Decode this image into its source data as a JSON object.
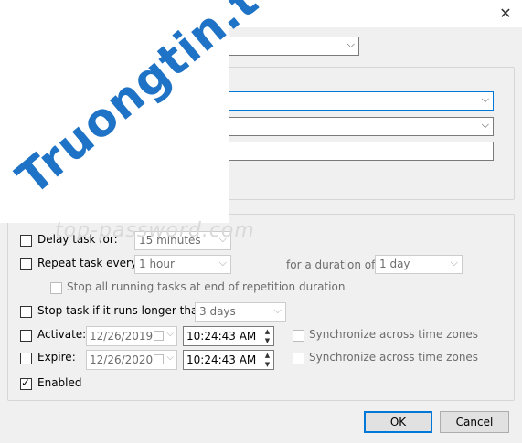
{
  "dialog": {
    "close_glyph": "✕"
  },
  "top_combo": {
    "value": ""
  },
  "settings": {
    "combo1": {
      "value": ""
    },
    "combo2": {
      "value": ""
    },
    "textbox": {
      "value": ""
    }
  },
  "advanced": {
    "delay_task": {
      "label": "Delay task for:",
      "checked": false,
      "value": "15 minutes"
    },
    "repeat_task": {
      "label": "Repeat task every:",
      "checked": false,
      "value": "1 hour"
    },
    "duration": {
      "label": "for a duration of:",
      "value": "1 day"
    },
    "stop_running": {
      "label": "Stop all running tasks at end of repetition duration",
      "checked": false
    },
    "stop_if_longer": {
      "label": "Stop task if it runs longer than:",
      "checked": false,
      "value": "3 days"
    },
    "activate": {
      "label": "Activate:",
      "checked": false,
      "date": "12/26/2019",
      "time": "10:24:43 AM"
    },
    "expire": {
      "label": "Expire:",
      "checked": false,
      "date": "12/26/2020",
      "time": "10:24:43 AM"
    },
    "sync_activate": {
      "label": "Synchronize across time zones",
      "checked": false
    },
    "sync_expire": {
      "label": "Synchronize across time zones",
      "checked": false
    },
    "enabled": {
      "label": "Enabled",
      "checked": true
    }
  },
  "buttons": {
    "ok": "OK",
    "cancel": "Cancel"
  },
  "watermark": {
    "main": "Truongtin.top",
    "secondary": "top-password.com"
  },
  "colors": {
    "accent": "#0078d7",
    "watermark": "#1e73c6"
  }
}
